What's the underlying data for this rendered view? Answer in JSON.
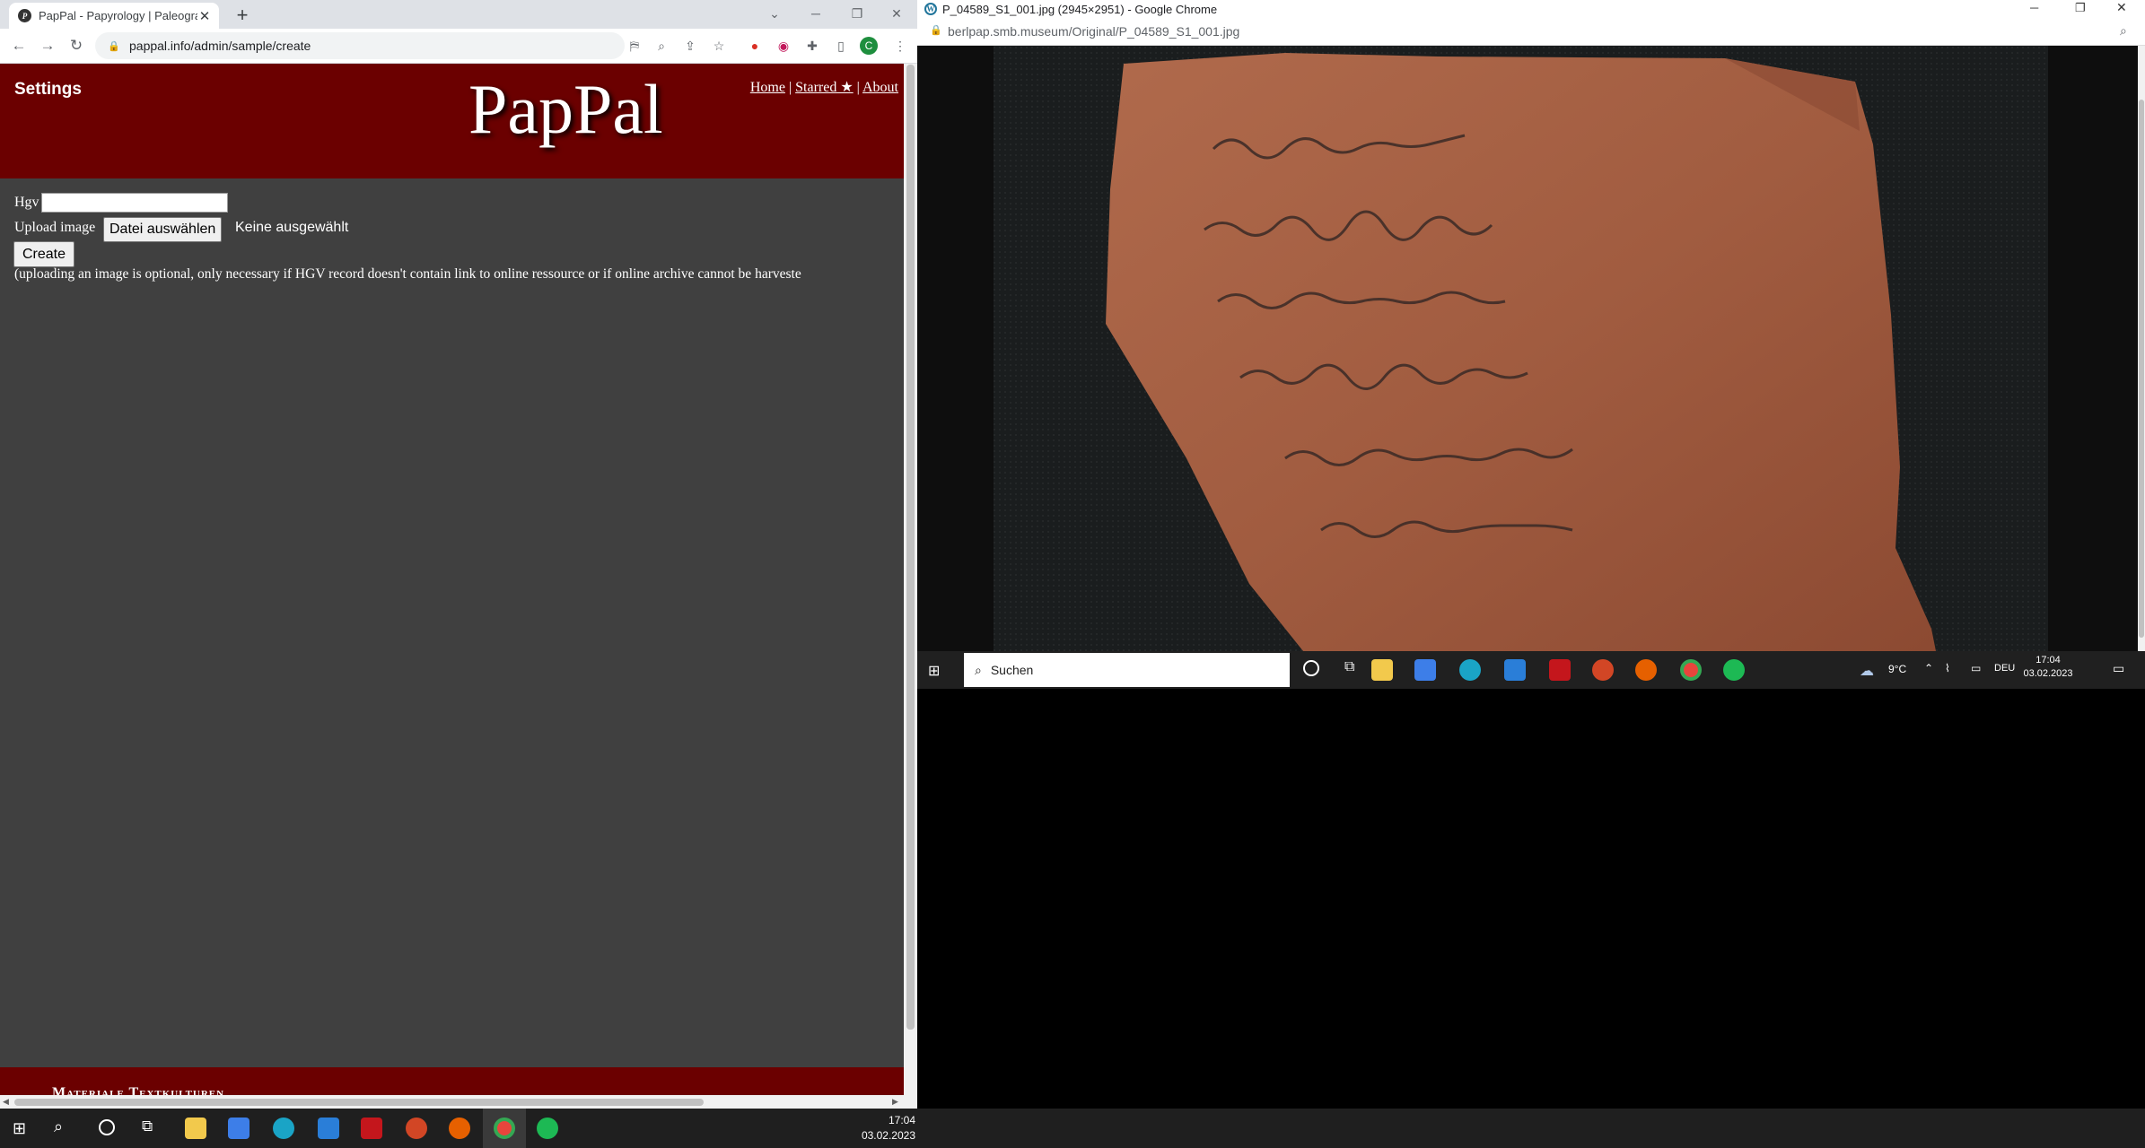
{
  "left_browser": {
    "tab_title": "PapPal - Papyrology | Paleograph",
    "tab_favicon": "P",
    "url": "pappal.info/admin/sample/create",
    "profile_initial": "C",
    "page": {
      "settings": "Settings",
      "logo": "PapPal",
      "nav": [
        "Home",
        "Starred ★",
        "About"
      ],
      "nav_sep": "|",
      "hgv_label": "Hgv",
      "hgv_value": "",
      "upload_label": "Upload image",
      "file_button": "Datei auswählen",
      "file_status": "Keine ausgewählt",
      "create_button": "Create",
      "note": "(uploading an image is optional, only necessary if HGV record doesn't contain link to online ressource or if online archive cannot be harveste",
      "footer_text": "Materiale Textkulturen"
    }
  },
  "right_browser": {
    "title": "P_04589_S1_001.jpg (2945×2951) - Google Chrome",
    "url": "berlpap.smb.museum/Original/P_04589_S1_001.jpg"
  },
  "small_taskbar": {
    "search_placeholder": "Suchen",
    "weather": "9°C",
    "lang": "DEU",
    "time": "17:04",
    "date": "03.02.2023"
  },
  "taskbar": {
    "time": "17:04",
    "date": "03.02.2023"
  },
  "colors": {
    "header_red": "#6b0000",
    "page_gray": "#404040"
  }
}
